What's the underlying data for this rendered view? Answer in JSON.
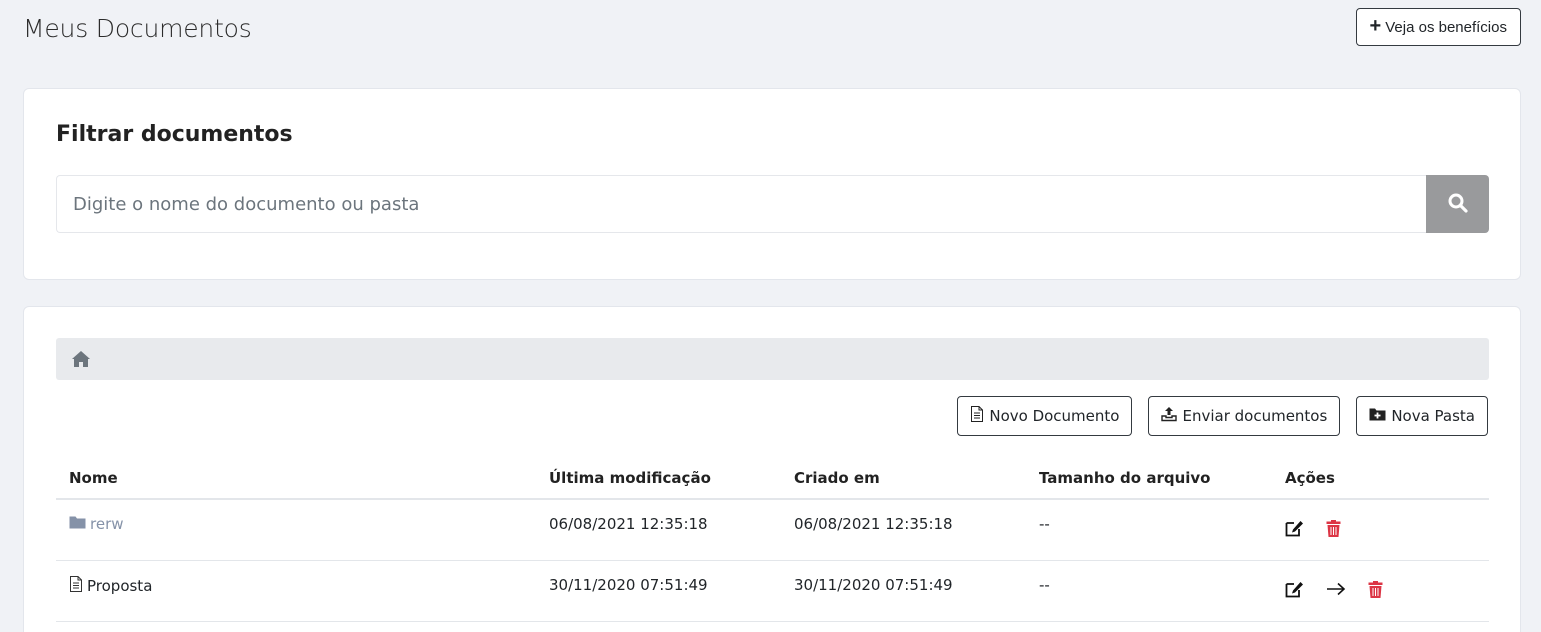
{
  "header": {
    "title": "Meus Documentos",
    "benefits_label": "Veja os benefícios"
  },
  "filter": {
    "title": "Filtrar documentos",
    "placeholder": "Digite o nome do documento ou pasta",
    "value": ""
  },
  "toolbar": {
    "new_document": "Novo Documento",
    "upload_documents": "Enviar documentos",
    "new_folder": "Nova Pasta"
  },
  "table": {
    "headers": {
      "name": "Nome",
      "modified": "Última modificação",
      "created": "Criado em",
      "size": "Tamanho do arquivo",
      "actions": "Ações"
    },
    "rows": [
      {
        "type": "folder",
        "name": "rerw",
        "modified": "06/08/2021 12:35:18",
        "created": "06/08/2021 12:35:18",
        "size": "--"
      },
      {
        "type": "document",
        "name": "Proposta",
        "modified": "30/11/2020 07:51:49",
        "created": "30/11/2020 07:51:49",
        "size": "--"
      }
    ]
  },
  "colors": {
    "background": "#f0f2f6",
    "search_button": "#999a9c",
    "delete_icon": "#dc3545",
    "folder_link": "#8592a8"
  }
}
